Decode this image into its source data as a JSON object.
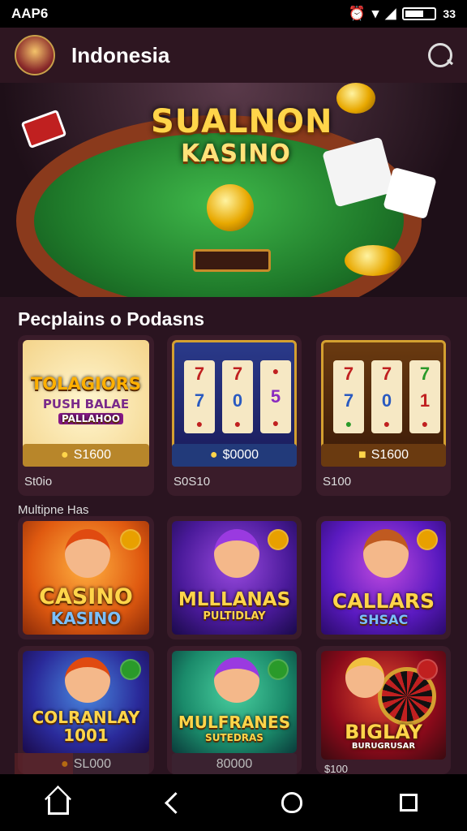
{
  "status_bar": {
    "carrier": "AAP6",
    "battery_text": "33"
  },
  "header": {
    "title": "Indonesia"
  },
  "hero": {
    "title": "SUALNON",
    "subtitle": "KASINO"
  },
  "section1": {
    "title": "Pecplains o Podasns",
    "cards": [
      {
        "game_title": "TOLAGIORS",
        "game_sub": "PUSH BALAE",
        "game_sub2": "PALLAHOO",
        "price": "S1600",
        "label": "St0io"
      },
      {
        "reels": [
          "7",
          "7",
          "●",
          "7",
          "0",
          "5",
          "●",
          "●",
          "●"
        ],
        "price": "$0000",
        "label": "S0S10"
      },
      {
        "reels": [
          "7",
          "7",
          "7",
          "7",
          "0",
          "1",
          "●",
          "●",
          "●"
        ],
        "price": "S1600",
        "label": "S100"
      }
    ]
  },
  "section2": {
    "title": "Multipne Has",
    "cards": [
      {
        "game_title": "CASINO",
        "game_sub": "KASINO"
      },
      {
        "game_title": "MLLLANAS",
        "game_sub": "PULTIDLAY"
      },
      {
        "game_title": "CALLARS",
        "game_sub": "SHSAC"
      },
      {
        "game_title": "COLRANLAY",
        "game_sub": "1001",
        "price": "SL000"
      },
      {
        "game_title": "MULFRANES",
        "game_sub": "SUTEDRAS",
        "price": "80000"
      },
      {
        "game_title": "BIGLAY",
        "game_sub": "BURUGRUSAR",
        "label": "$100"
      }
    ]
  },
  "colors": {
    "background": "#2a1420",
    "card": "#3a1c2a",
    "accent_gold": "#ffd54a"
  },
  "nav": {
    "items": [
      "home-icon",
      "back-icon",
      "home-circle-icon",
      "recents-icon"
    ]
  }
}
